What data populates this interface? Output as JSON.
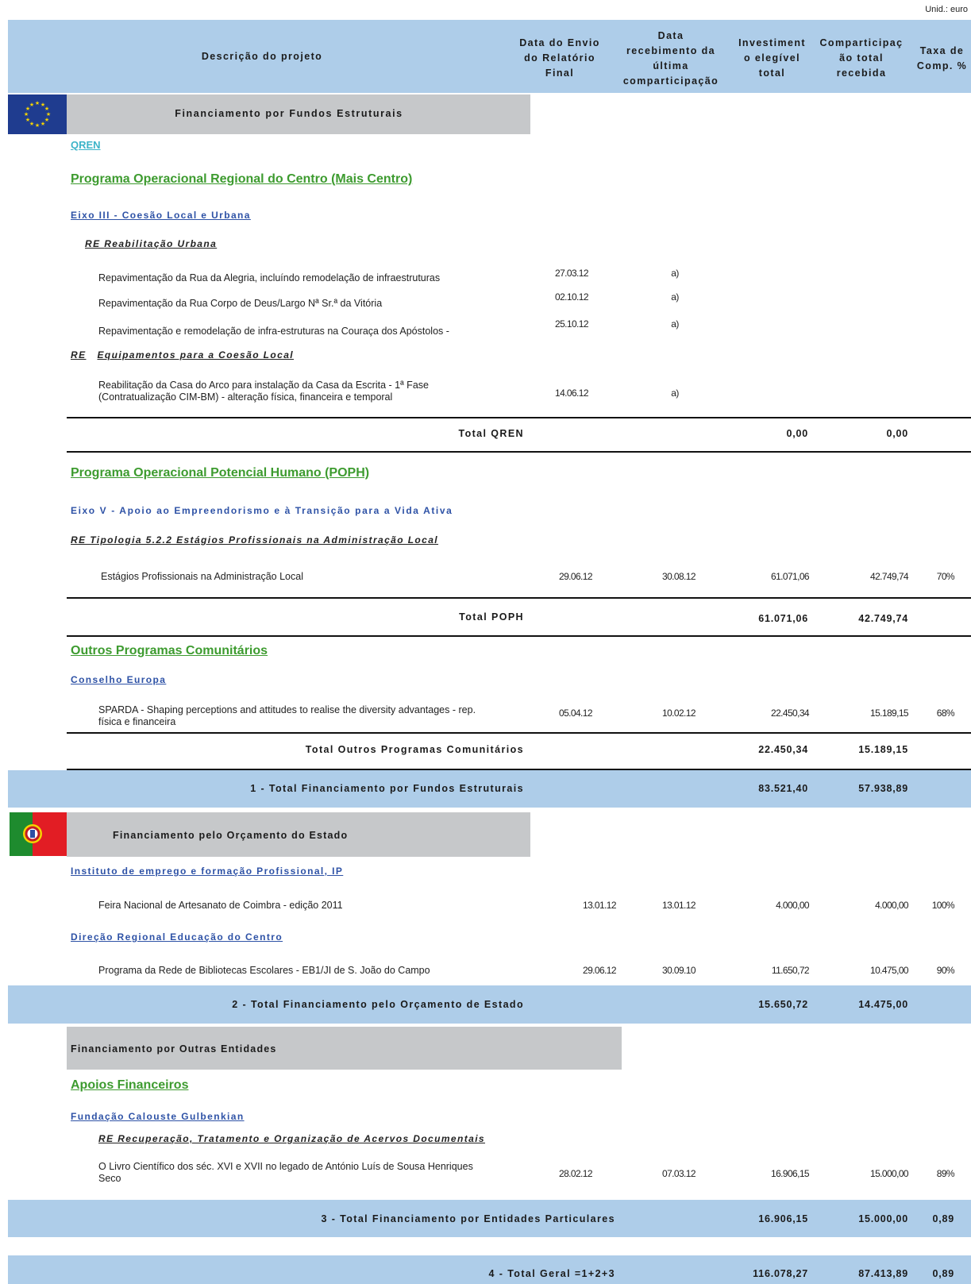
{
  "unit": "Unid.: euro",
  "header": {
    "desc": "Descrição do projeto",
    "envio": [
      "Data do Envio",
      "do Relatório",
      "Final"
    ],
    "receb": [
      "Data",
      "recebimento da",
      "última",
      "comparticipação"
    ],
    "invest": [
      "Investiment",
      "o elegível",
      "total"
    ],
    "compart": [
      "Comparticipaç",
      "ão total",
      "recebida"
    ],
    "taxa": [
      "Taxa de",
      "Comp. %"
    ]
  },
  "s1": {
    "title": "Financiamento por Fundos Estruturais",
    "qren": "QREN",
    "pro_centro": "Programa Operacional Regional do Centro (Mais Centro)",
    "eixo3": "Eixo III - Coesão Local e Urbana",
    "re_reab_pre": "RE",
    "re_reab": "Reabilitação Urbana",
    "rows_reab": [
      {
        "desc": "Repavimentação da Rua da Alegria, incluíndo remodelação de infraestruturas",
        "envio": "27.03.12",
        "receb": "a)"
      },
      {
        "desc": "Repavimentação da Rua Corpo de Deus/Largo Nª Sr.ª da Vitória",
        "envio": "02.10.12",
        "receb": "a)"
      },
      {
        "desc": "Repavimentação e remodelação de infra-estruturas na Couraça dos Apóstolos -",
        "envio": "25.10.12",
        "receb": "a)"
      }
    ],
    "re_equip_pre": "RE",
    "re_equip": "Equipamentos para a Coesão Local",
    "casa_arco_1": "Reabilitação da Casa do Arco para instalação da Casa da Escrita - 1ª Fase",
    "casa_arco_2": "(Contratualização CIM-BM) - alteração física, financeira e temporal",
    "casa_arco_envio": "14.06.12",
    "casa_arco_receb": "a)",
    "total_qren_label": "Total QREN",
    "total_qren_invest": "0,00",
    "total_qren_compart": "0,00",
    "poph": "Programa Operacional Potencial Humano (POPH)",
    "eixo5": "Eixo V - Apoio ao Empreendorismo e à Transição para a Vida Ativa",
    "re_tipologia": "RE Tipologia 5.2.2 Estágios Profissionais na Administração Local",
    "estagios": {
      "desc": "Estágios Profissionais na Administração Local",
      "envio": "29.06.12",
      "receb": "30.08.12",
      "invest": "61.071,06",
      "compart": "42.749,74",
      "taxa": "70%"
    },
    "total_poph_label": "Total POPH",
    "total_poph_invest": "61.071,06",
    "total_poph_compart": "42.749,74",
    "outros": "Outros Programas Comunitários",
    "conselho": "Conselho Europa",
    "sparda_1": "SPARDA - Shaping perceptions and attitudes to realise the diversity advantages - rep.",
    "sparda_2": "física e financeira",
    "sparda": {
      "envio": "05.04.12",
      "receb": "10.02.12",
      "invest": "22.450,34",
      "compart": "15.189,15",
      "taxa": "68%"
    },
    "total_outros_label": "Total Outros Programas Comunitários",
    "total_outros_invest": "22.450,34",
    "total_outros_compart": "15.189,15",
    "total1_label": "1 - Total Financiamento por Fundos Estruturais",
    "total1_invest": "83.521,40",
    "total1_compart": "57.938,89"
  },
  "s2": {
    "title": "Financiamento pelo Orçamento do Estado",
    "iefp": "Instituto de emprego e formação Profissional, IP",
    "feira": {
      "desc": "Feira Nacional de Artesanato de Coimbra - edição 2011",
      "envio": "13.01.12",
      "receb": "13.01.12",
      "invest": "4.000,00",
      "compart": "4.000,00",
      "taxa": "100%"
    },
    "drec": "Direção Regional Educação do Centro",
    "rede": {
      "desc": "Programa da Rede de Bibliotecas Escolares - EB1/JI de S. João do Campo",
      "envio": "29.06.12",
      "receb": "30.09.10",
      "invest": "11.650,72",
      "compart": "10.475,00",
      "taxa": "90%"
    },
    "total2_label": "2 - Total Financiamento pelo Orçamento de Estado",
    "total2_invest": "15.650,72",
    "total2_compart": "14.475,00"
  },
  "s3": {
    "title": "Financiamento por Outras Entidades",
    "apoios": "Apoios Financeiros",
    "gulbenkian": "Fundação Calouste Gulbenkian",
    "re_acervos": "RE Recuperação, Tratamento e Organização de Acervos Documentais",
    "livro_1": "O Livro Científico dos séc. XVI e XVII no legado de António Luís de Sousa Henriques",
    "livro_2": "Seco",
    "livro": {
      "envio": "28.02.12",
      "receb": "07.03.12",
      "invest": "16.906,15",
      "compart": "15.000,00",
      "taxa": "89%"
    },
    "total3_label": "3 - Total Financiamento por Entidades Particulares",
    "total3_invest": "16.906,15",
    "total3_compart": "15.000,00",
    "total3_taxa": "0,89"
  },
  "total4": {
    "label": "4 - Total Geral =1+2+3",
    "invest": "116.078,27",
    "compart": "87.413,89",
    "taxa": "0,89"
  },
  "colors": {
    "header_blue": "#aecde9",
    "grey": "#c6c8ca",
    "green": "#3d9b2f",
    "blue": "#2e52a6",
    "eu_blue": "#1f3c8f",
    "pt_green": "#1e8b2e",
    "pt_red": "#e21d24"
  },
  "icons": {
    "eu_flag": "eu-flag-icon",
    "pt_flag": "portugal-flag-icon"
  }
}
